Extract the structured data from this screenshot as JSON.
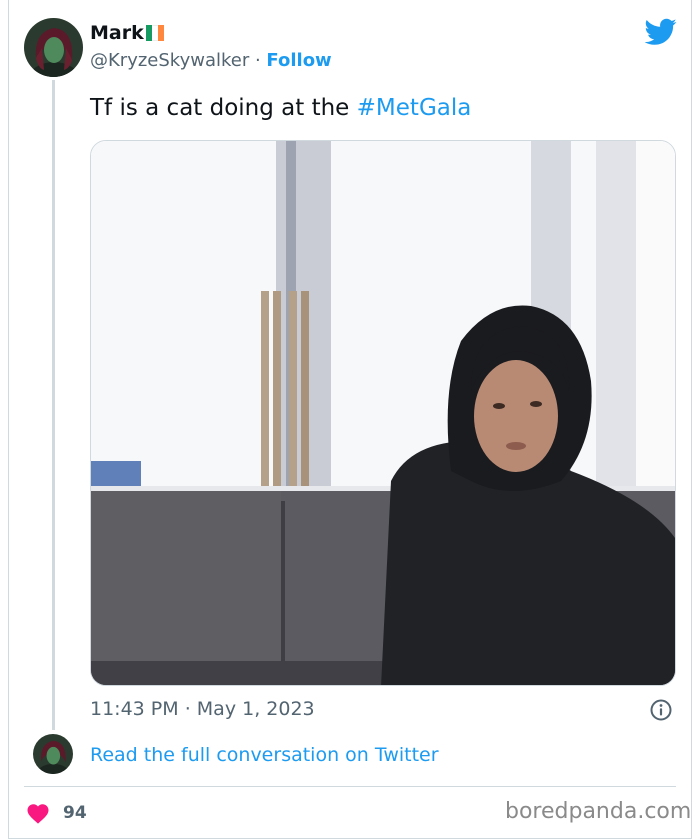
{
  "tweet": {
    "display_name": "Mark",
    "flag_colors": [
      "#169b62",
      "#ffffff",
      "#ff883e"
    ],
    "handle": "@KryzeSkywalker",
    "separator": " · ",
    "follow_label": "Follow",
    "text_prefix": "Tf is a cat doing at the ",
    "hashtag": "#MetGala",
    "time": "11:43 PM",
    "date_separator": " · ",
    "date": "May 1, 2023",
    "read_full_label": "Read the full conversation on Twitter",
    "like_count": "94"
  },
  "watermark": "boredpanda.com",
  "colors": {
    "accent": "#1d9bf0",
    "heart": "#f91880",
    "muted": "#536471"
  },
  "icons": {
    "brand": "twitter-bird-icon",
    "info": "info-icon",
    "like": "heart-icon"
  }
}
